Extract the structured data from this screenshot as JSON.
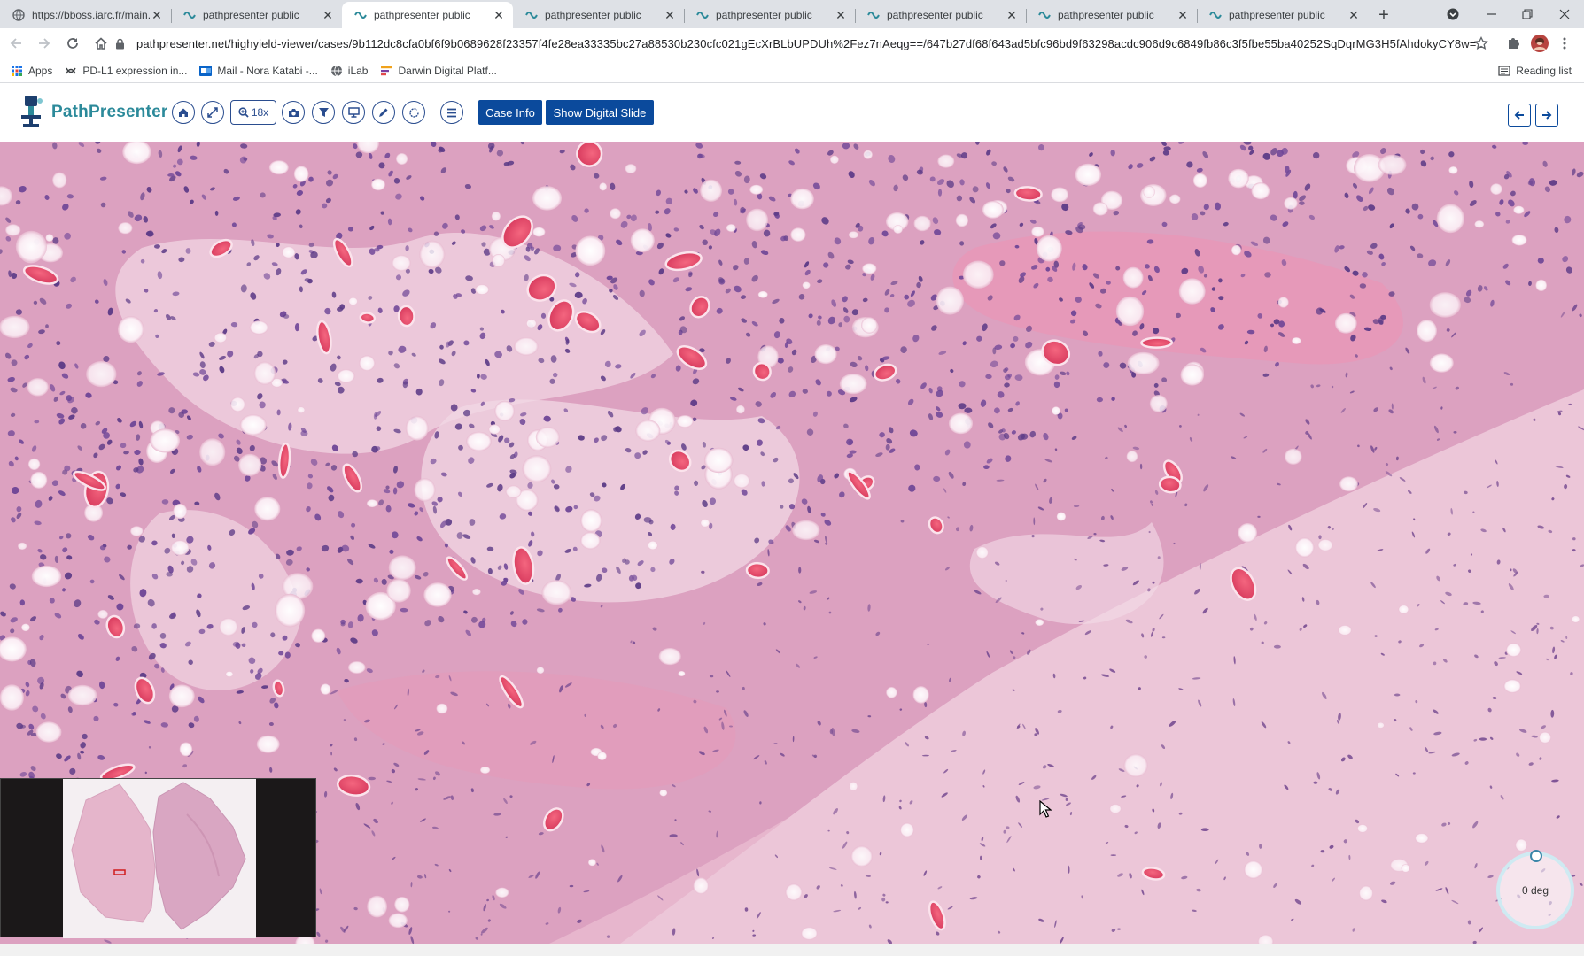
{
  "browser": {
    "tabs": [
      {
        "title": "https://bboss.iarc.fr/main.p",
        "active": false
      },
      {
        "title": "pathpresenter public",
        "active": false
      },
      {
        "title": "pathpresenter public",
        "active": true
      },
      {
        "title": "pathpresenter public",
        "active": false
      },
      {
        "title": "pathpresenter public",
        "active": false
      },
      {
        "title": "pathpresenter public",
        "active": false
      },
      {
        "title": "pathpresenter public",
        "active": false
      },
      {
        "title": "pathpresenter public",
        "active": false
      }
    ],
    "url": "pathpresenter.net/highyield-viewer/cases/9b112dc8cfa0bf6f9b0689628f23357f4fe28ea33335bc27a88530b230cfc021gEcXrBLbUPDUh%2Fez7nAeqg==/647b27df68f643ad5bfc96bd9f63298acdc906d9c6849fb86c3f5fbe55ba40252SqDqrMG3H5fAhdokyCY8w=...",
    "bookmarks": [
      {
        "label": "Apps",
        "icon": "apps-grid-icon"
      },
      {
        "label": "PD-L1 expression in...",
        "icon": "link-icon"
      },
      {
        "label": "Mail - Nora Katabi -...",
        "icon": "outlook-icon"
      },
      {
        "label": "iLab",
        "icon": "globe-icon"
      },
      {
        "label": "Darwin Digital Platf...",
        "icon": "darwin-icon"
      }
    ],
    "reading_list": "Reading list"
  },
  "app": {
    "brand": "PathPresenter",
    "zoom_label": "18x",
    "case_info_label": "Case Info",
    "show_slide_label": "Show Digital Slide",
    "rotation_label": "0 deg"
  },
  "colors": {
    "brand_teal": "#2c8a9a",
    "primary_blue": "#0b4a9c",
    "tool_outline": "#2a4d8f",
    "tissue_pink": "#e9b8cf"
  }
}
